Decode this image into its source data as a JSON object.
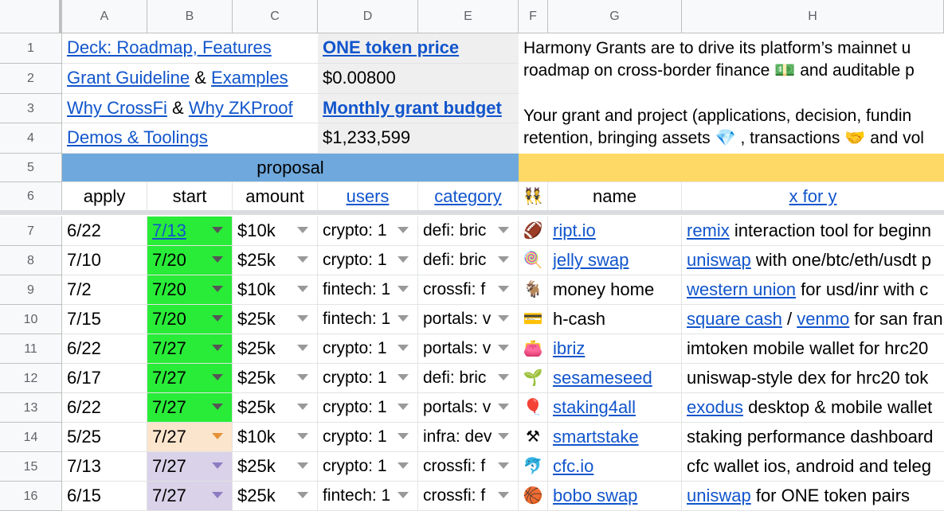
{
  "columns": [
    "A",
    "B",
    "C",
    "D",
    "E",
    "F",
    "G",
    "H"
  ],
  "rows": [
    "1",
    "2",
    "3",
    "4",
    "5",
    "6",
    "7",
    "8",
    "9",
    "10",
    "11",
    "12",
    "13",
    "14",
    "15",
    "16"
  ],
  "info": {
    "a1": "Deck: Roadmap, Features",
    "a2_link1": "Grant Guideline",
    "a2_amp": "&",
    "a2_link2": "Examples",
    "a3_link1": "Why CrossFi",
    "a3_amp": "&",
    "a3_link2": "Why ZKProof",
    "a4": "Demos & Toolings",
    "d1": "ONE token price",
    "d2": "$0.00800",
    "d3": "Monthly grant budget",
    "d4": "$1,233,599",
    "f1": "Harmony Grants are to drive its platform’s mainnet u",
    "f2_pre": "roadmap on cross-border finance",
    "f2_emoji": "💵",
    "f2_post": "and auditable p",
    "f3": "Your grant and project (applications, decision, fundin",
    "f4_pre": "retention, bringing assets",
    "f4_e1": "💎",
    "f4_mid": ", transactions",
    "f4_e2": "🤝",
    "f4_post": "and vol"
  },
  "section": {
    "proposal": "proposal"
  },
  "headers": {
    "apply": "apply",
    "start": "start",
    "amount": "amount",
    "users": "users",
    "category": "category",
    "team_emoji": "👯",
    "name": "name",
    "xfory": "x for y"
  },
  "table": [
    {
      "row": "7",
      "apply": "6/22",
      "start": "7/13",
      "start_link": true,
      "start_color": "green",
      "amount": "$10k",
      "users": "crypto: 1",
      "category": "defi: bric",
      "emoji": "🏈",
      "name": "ript.io",
      "name_link": true,
      "x_link": "remix",
      "x_rest": " interaction tool for beginn"
    },
    {
      "row": "8",
      "apply": "7/10",
      "start": "7/20",
      "start_color": "green",
      "amount": "$25k",
      "users": "crypto: 1",
      "category": "defi: bric",
      "emoji": "🍭",
      "name": "jelly swap",
      "name_link": true,
      "x_link": "uniswap",
      "x_rest": " with one/btc/eth/usdt p"
    },
    {
      "row": "9",
      "apply": "7/2",
      "start": "7/20",
      "start_color": "green",
      "amount": "$10k",
      "users": "fintech: 1",
      "category": "crossfi: f",
      "emoji": "🐐",
      "name": "money home",
      "name_link": false,
      "x_link": "western union",
      "x_rest": " for usd/inr with c"
    },
    {
      "row": "10",
      "apply": "7/15",
      "start": "7/20",
      "start_color": "green",
      "amount": "$25k",
      "users": "fintech: 1",
      "category": "portals: v",
      "emoji": "💳",
      "name": "h-cash",
      "name_link": false,
      "x_link": "square cash",
      "x_mid": " / ",
      "x_link2": "venmo",
      "x_rest": " for san fran"
    },
    {
      "row": "11",
      "apply": "6/22",
      "start": "7/27",
      "start_color": "green",
      "amount": "$25k",
      "users": "crypto: 1",
      "category": "portals: v",
      "emoji": "👛",
      "name": "ibriz",
      "name_link": true,
      "x_link": "",
      "x_rest": "imtoken mobile wallet for hrc20"
    },
    {
      "row": "12",
      "apply": "6/17",
      "start": "7/27",
      "start_color": "green",
      "amount": "$25k",
      "users": "crypto: 1",
      "category": "defi: bric",
      "emoji": "🌱",
      "name": "sesameseed",
      "name_link": true,
      "x_link": "",
      "x_rest": "uniswap-style dex for hrc20 tok"
    },
    {
      "row": "13",
      "apply": "6/22",
      "start": "7/27",
      "start_color": "green",
      "amount": "$25k",
      "users": "crypto: 1",
      "category": "portals: v",
      "emoji": "🎈",
      "name": "staking4all",
      "name_link": true,
      "x_link": "exodus",
      "x_rest": " desktop & mobile wallet"
    },
    {
      "row": "14",
      "apply": "5/25",
      "start": "7/27",
      "start_color": "peach",
      "amount": "$10k",
      "users": "crypto: 1",
      "category": "infra: dev",
      "emoji": "⚒",
      "name": "smartstake",
      "name_link": true,
      "x_link": "",
      "x_rest": "staking performance dashboard"
    },
    {
      "row": "15",
      "apply": "7/13",
      "start": "7/27",
      "start_color": "lav",
      "amount": "$25k",
      "users": "crypto: 1",
      "category": "crossfi: f",
      "emoji": "🐬",
      "name": "cfc.io",
      "name_link": true,
      "x_link": "",
      "x_rest": "cfc wallet ios, android and teleg"
    },
    {
      "row": "16",
      "apply": "6/15",
      "start": "7/27",
      "start_color": "lav",
      "amount": "$25k",
      "users": "fintech: 1",
      "category": "crossfi: f",
      "emoji": "🏀",
      "name": "bobo swap",
      "name_link": true,
      "x_link": "uniswap",
      "x_rest": " for ONE token pairs"
    }
  ],
  "colors": {
    "proposal_band": "#6fa8dc",
    "yellow_band": "#ffd966",
    "green": "#29ec38",
    "peach": "#fce5cd",
    "lavender": "#d9d2e9",
    "link": "#1155cc"
  }
}
